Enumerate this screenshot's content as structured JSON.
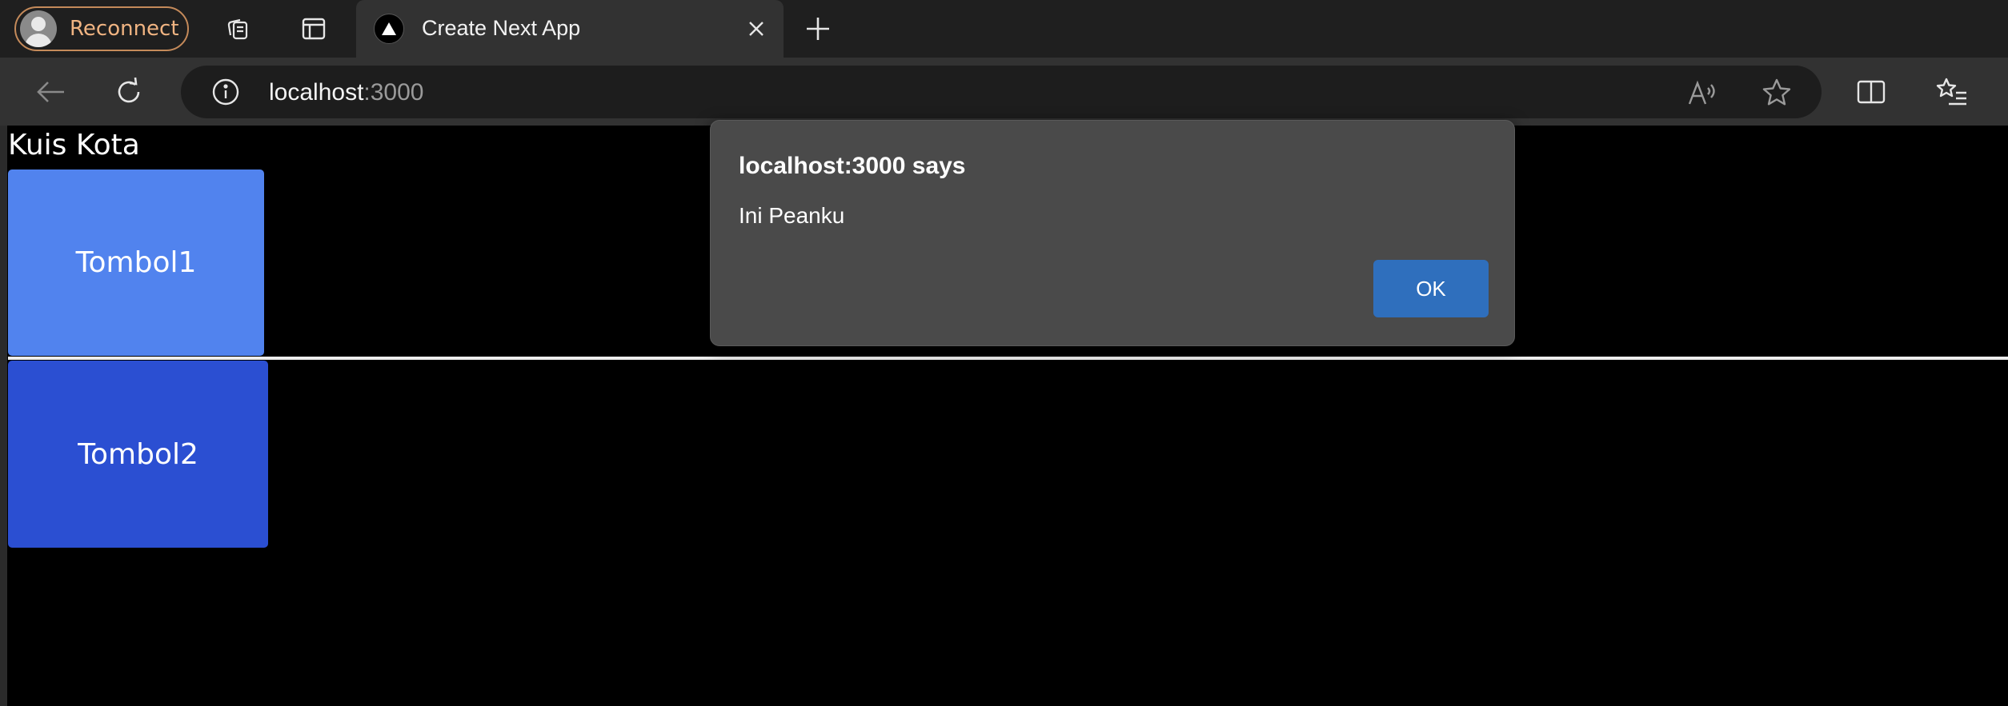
{
  "browser": {
    "profile_label": "Reconnect",
    "tab": {
      "title": "Create Next App"
    },
    "address": {
      "host": "localhost",
      "port": ":3000"
    }
  },
  "page": {
    "heading": "Kuis Kota",
    "buttons": [
      {
        "label": "Tombol1",
        "color": "#5183ee"
      },
      {
        "label": "Tombol2",
        "color": "#2b4fd2"
      }
    ]
  },
  "alert": {
    "title": "localhost:3000 says",
    "message": "Ini Peanku",
    "ok_label": "OK"
  },
  "icons": {
    "profile": "avatar-icon",
    "collections": "collections-icon",
    "tab_actions": "tab-actions-icon",
    "tab_favicon": "nextjs-triangle-icon",
    "tab_close": "close-icon",
    "new_tab": "plus-icon",
    "back": "back-arrow-icon",
    "refresh": "refresh-icon",
    "site_info": "info-icon",
    "read_aloud": "read-aloud-icon",
    "favorite": "star-icon",
    "split_screen": "split-screen-icon",
    "favorites": "favorites-list-icon"
  },
  "colors": {
    "accent": "#2f6fbd",
    "profile_border": "#c48a5a",
    "dialog_bg": "#4a4a4a"
  }
}
